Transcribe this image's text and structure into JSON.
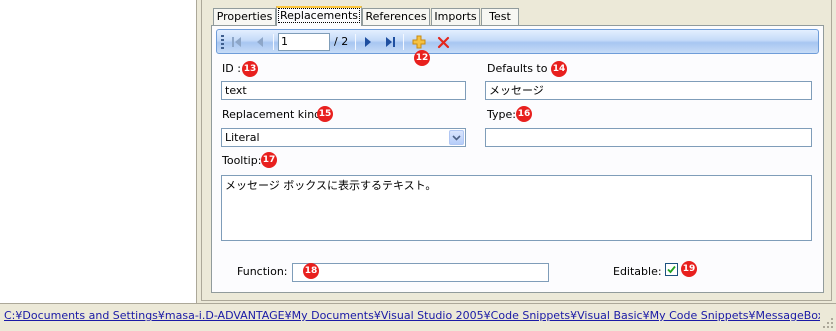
{
  "tabs": [
    {
      "label": "Properties",
      "active": false
    },
    {
      "label": "Replacements",
      "active": true
    },
    {
      "label": "References",
      "active": false
    },
    {
      "label": "Imports",
      "active": false
    },
    {
      "label": "Test",
      "active": false
    }
  ],
  "navigator": {
    "position_value": "1",
    "total_label": "/ 2",
    "icons": [
      "move-first-icon",
      "move-previous-icon",
      "move-next-icon",
      "move-last-icon",
      "add-new-icon",
      "delete-icon"
    ]
  },
  "callouts": {
    "c12": "12",
    "c13": "13",
    "c14": "14",
    "c15": "15",
    "c16": "16",
    "c17": "17",
    "c18": "18",
    "c19": "19"
  },
  "form": {
    "id_label": "ID :",
    "id_value": "text",
    "defaults_label": "Defaults to :",
    "defaults_value": "メッセージ",
    "kind_label": "Replacement kind:",
    "kind_value": "Literal",
    "type_label": "Type:",
    "type_value": "",
    "tooltip_label": "Tooltip:",
    "tooltip_value": "メッセージ ボックスに表示するテキスト。",
    "function_label": "Function:",
    "function_value": "",
    "editable_label": "Editable:",
    "editable_checked": true
  },
  "status_bar": {
    "path": "C:¥Documents and Settings¥masa-i.D-ADVANTAGE¥My Documents¥Visual Studio 2005¥Code Snippets¥Visual Basic¥My Code Snippets¥MessageBoxShow.snippet"
  },
  "colors": {
    "callout": "#e8201e",
    "toolbar_blue": "#a8c6f1",
    "link": "#1a1aa6"
  }
}
